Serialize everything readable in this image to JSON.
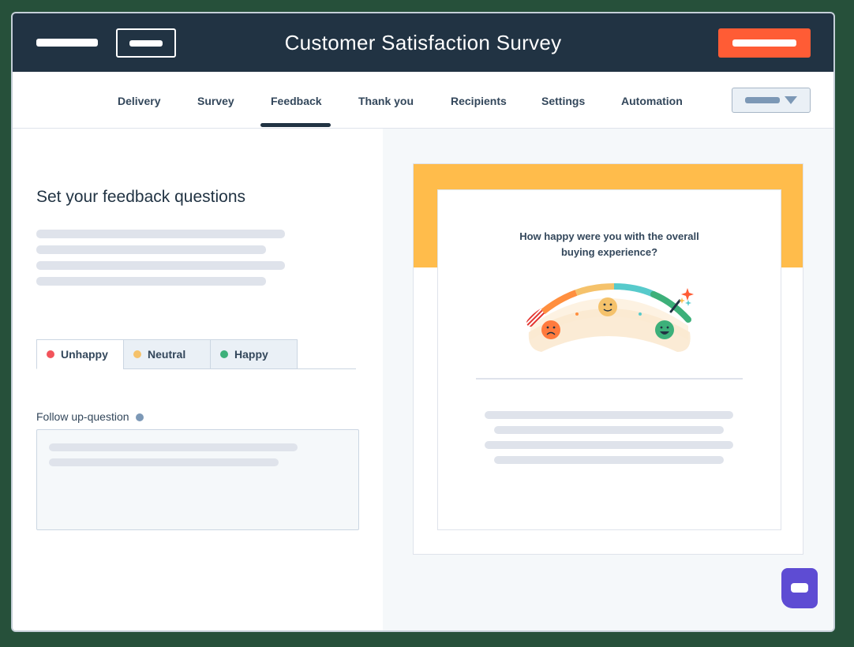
{
  "header": {
    "title": "Customer Satisfaction Survey"
  },
  "tabs": [
    {
      "label": "Delivery",
      "active": false
    },
    {
      "label": "Survey",
      "active": false
    },
    {
      "label": "Feedback",
      "active": true
    },
    {
      "label": "Thank you",
      "active": false
    },
    {
      "label": "Recipients",
      "active": false
    },
    {
      "label": "Settings",
      "active": false
    },
    {
      "label": "Automation",
      "active": false
    }
  ],
  "editor": {
    "section_title": "Set your feedback questions",
    "sentiment_tabs": [
      {
        "label": "Unhappy",
        "color": "#f2545b",
        "active": true
      },
      {
        "label": "Neutral",
        "color": "#f5c26b",
        "active": false
      },
      {
        "label": "Happy",
        "color": "#3db07a",
        "active": false
      }
    ],
    "followup_label": "Follow up-question"
  },
  "preview": {
    "question": "How happy were you with the overall buying experience?"
  },
  "colors": {
    "header_bg": "#213343",
    "primary_button": "#ff5c35",
    "preview_band": "#ffbc4b",
    "chat_button": "#5e4cd3"
  }
}
